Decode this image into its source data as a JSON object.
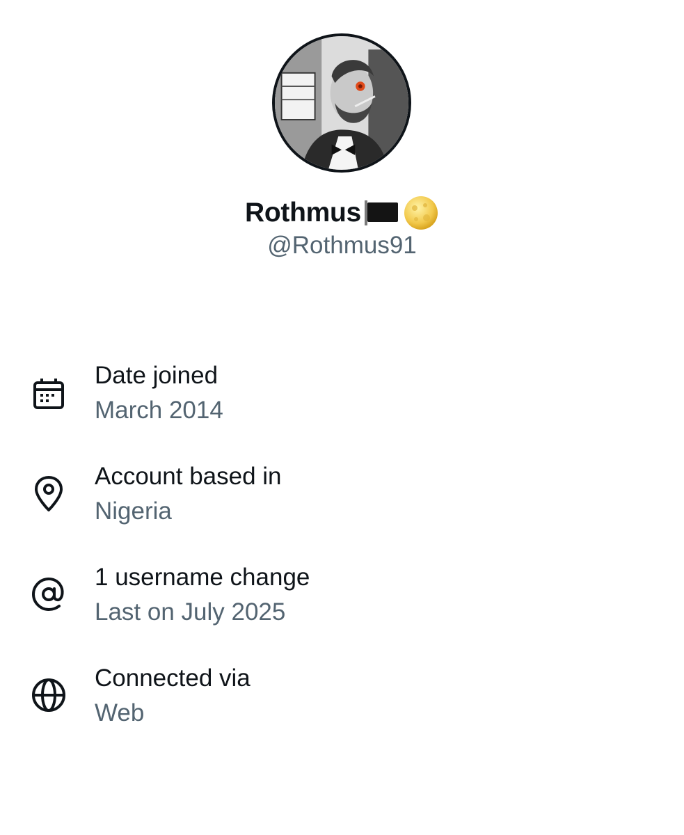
{
  "profile": {
    "display_name": "Rothmus",
    "name_emojis": [
      "black-flag-icon",
      "full-moon-face-icon"
    ],
    "handle": "@Rothmus91"
  },
  "info": [
    {
      "icon": "calendar-icon",
      "title": "Date joined",
      "value": "March 2014"
    },
    {
      "icon": "location-pin-icon",
      "title": "Account based in",
      "value": "Nigeria"
    },
    {
      "icon": "at-sign-icon",
      "title": "1 username change",
      "value": "Last on July 2025"
    },
    {
      "icon": "globe-icon",
      "title": "Connected via",
      "value": "Web"
    }
  ],
  "colors": {
    "primary_text": "#0f1419",
    "secondary_text": "#536471",
    "background": "#ffffff"
  }
}
